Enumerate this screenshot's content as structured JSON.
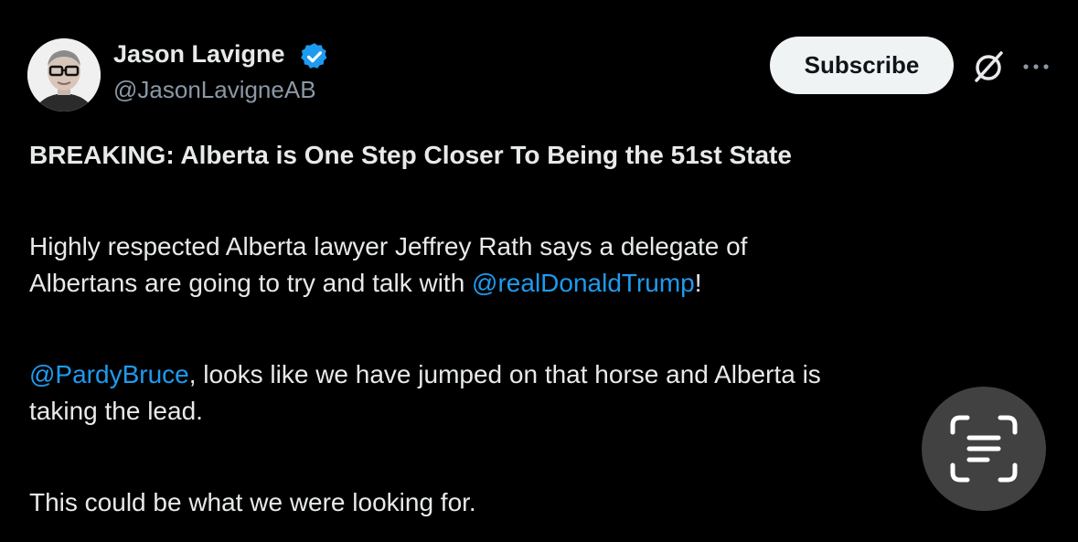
{
  "author": {
    "display_name": "Jason Lavigne",
    "handle": "@JasonLavigneAB",
    "verified_icon": "verified-badge-icon"
  },
  "actions": {
    "subscribe_label": "Subscribe",
    "grok_icon": "grok-icon",
    "more_icon": "more-dots-icon"
  },
  "tweet": {
    "headline": "BREAKING: Alberta is One Step Closer To Being the 51st State",
    "p1_line1": "Highly respected Alberta lawyer Jeffrey Rath says a delegate of",
    "p1_line2_start": "Albertans are going to try and talk with ",
    "p1_mention": "@realDonaldTrump",
    "p1_line2_end": "!",
    "p2_mention": "@PardyBruce",
    "p2_line1_rest": ", looks like we have jumped on that horse and Alberta is",
    "p2_line2": "taking the lead.",
    "p3": "This could be what we were looking for."
  },
  "overlay": {
    "text_scan_icon": "text-scan-icon"
  },
  "colors": {
    "background": "#000000",
    "text": "#e7e9ea",
    "secondary_text": "#8b98a5",
    "link": "#1d9bf0",
    "verified": "#1d9bf0"
  }
}
